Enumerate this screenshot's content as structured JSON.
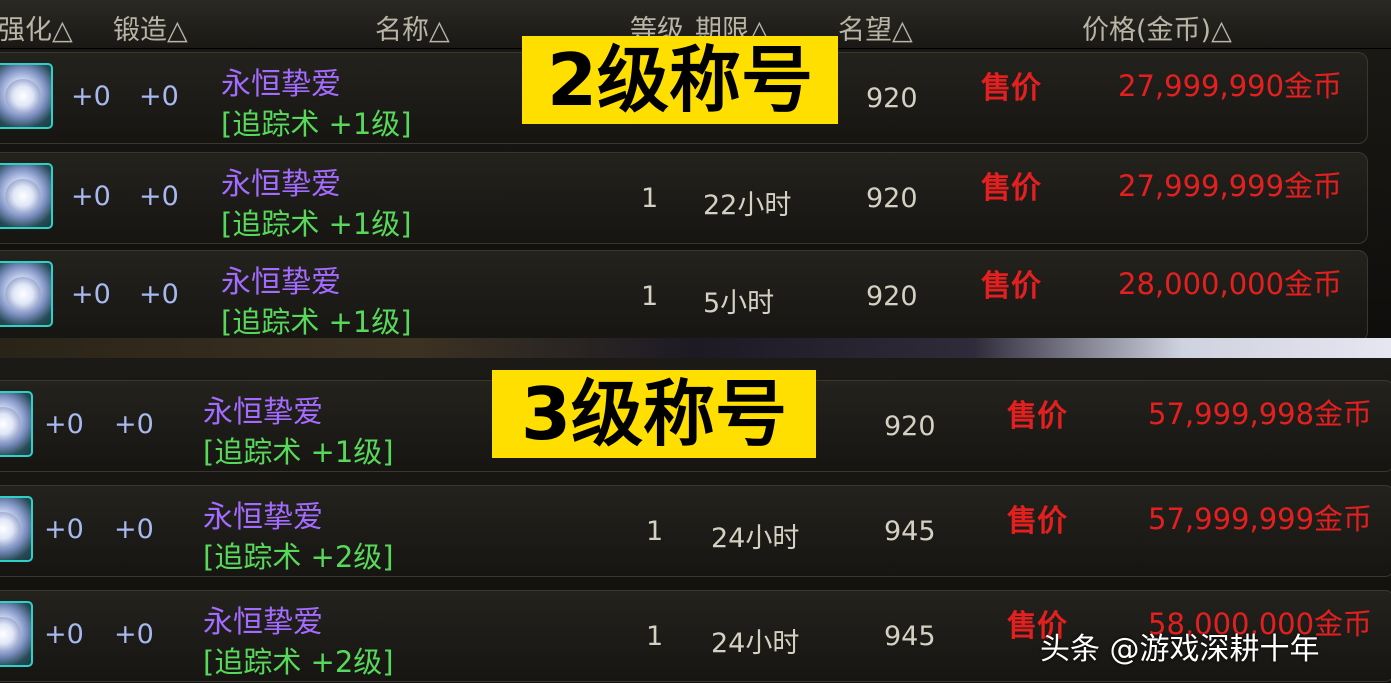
{
  "header": {
    "enhance": "强化△",
    "forge": "锻造△",
    "name": "名称△",
    "level": "等级",
    "expiry": "期限△",
    "fame": "名望△",
    "price": "价格(金币)△"
  },
  "overlays": {
    "level2": "2级称号",
    "level3": "3级称号"
  },
  "top_rows": [
    {
      "enhance": "+0",
      "forge": "+0",
      "name": "永恒挚爱",
      "skill": "[追踪术 +1级]",
      "level": "",
      "expiry": "",
      "fame": "920",
      "sale": "售价",
      "price": "27,999,990金币"
    },
    {
      "enhance": "+0",
      "forge": "+0",
      "name": "永恒挚爱",
      "skill": "[追踪术 +1级]",
      "level": "1",
      "expiry": "22小时",
      "fame": "920",
      "sale": "售价",
      "price": "27,999,999金币"
    },
    {
      "enhance": "+0",
      "forge": "+0",
      "name": "永恒挚爱",
      "skill": "[追踪术 +1级]",
      "level": "1",
      "expiry": "5小时",
      "fame": "920",
      "sale": "售价",
      "price": "28,000,000金币"
    }
  ],
  "bottom_rows": [
    {
      "enhance": "+0",
      "forge": "+0",
      "name": "永恒挚爱",
      "skill": "[追踪术 +1级]",
      "level": "",
      "expiry": "",
      "fame": "920",
      "sale": "售价",
      "price": "57,999,998金币"
    },
    {
      "enhance": "+0",
      "forge": "+0",
      "name": "永恒挚爱",
      "skill": "[追踪术 +2级]",
      "level": "1",
      "expiry": "24小时",
      "fame": "945",
      "sale": "售价",
      "price": "57,999,999金币"
    },
    {
      "enhance": "+0",
      "forge": "+0",
      "name": "永恒挚爱",
      "skill": "[追踪术 +2级]",
      "level": "1",
      "expiry": "24小时",
      "fame": "945",
      "sale": "售价",
      "price": "58,000,000金币"
    }
  ],
  "watermark": "头条 @游戏深耕十年",
  "colors": {
    "item_name": "#a46bff",
    "skill_text": "#58d85b",
    "price_red": "#e3201f",
    "overlay_yellow": "#ffdf00",
    "icon_border": "#2fd0c8"
  },
  "icons": {
    "item": "flower-bouquet-icon"
  }
}
